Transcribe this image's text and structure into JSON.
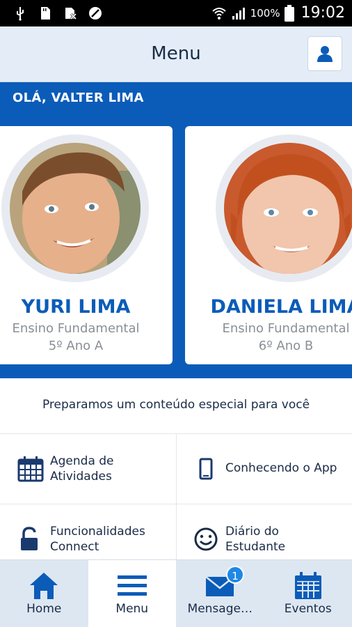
{
  "status_bar": {
    "battery": "100%",
    "time": "19:02"
  },
  "header": {
    "title": "Menu"
  },
  "greeting": "OLÁ, VALTER LIMA",
  "students": [
    {
      "name": "YURI LIMA",
      "level": "Ensino Fundamental",
      "class": "5º Ano A"
    },
    {
      "name": "DANIELA LIMA",
      "level": "Ensino Fundamental",
      "class": "6º Ano B"
    }
  ],
  "promo": "Preparamos um conteúdo especial para você",
  "tiles": [
    {
      "icon": "calendar-icon",
      "label_line1": "Agenda de",
      "label_line2": "Atividades"
    },
    {
      "icon": "phone-icon",
      "label_line1": "Conhecendo o App",
      "label_line2": ""
    },
    {
      "icon": "unlock-icon",
      "label_line1": "Funcionalidades",
      "label_line2": "Connect"
    },
    {
      "icon": "smiley-icon",
      "label_line1": "Diário do",
      "label_line2": "Estudante"
    }
  ],
  "bottom_nav": [
    {
      "label": "Home",
      "icon": "home-icon"
    },
    {
      "label": "Menu",
      "icon": "hamburger-icon"
    },
    {
      "label": "Mensage…",
      "icon": "mail-icon",
      "badge": "1"
    },
    {
      "label": "Eventos",
      "icon": "calendar-icon"
    }
  ],
  "colors": {
    "brand_blue": "#0b5cb8",
    "header_bg": "#e4edf7",
    "text_dark": "#1a2b46",
    "muted": "#8a8f96"
  }
}
